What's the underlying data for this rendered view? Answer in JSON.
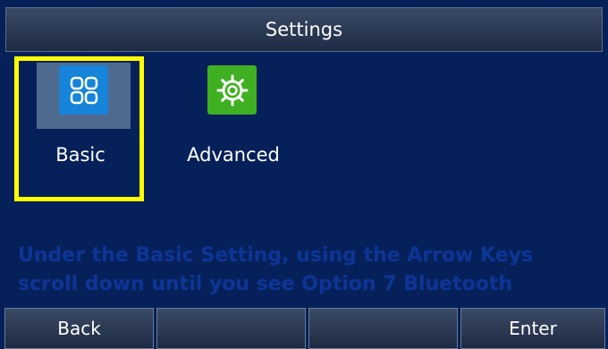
{
  "titlebar": {
    "title": "Settings"
  },
  "menu": {
    "items": [
      {
        "label": "Basic",
        "icon": "grid-icon",
        "color": "#1684d8",
        "selected": true
      },
      {
        "label": "Advanced",
        "icon": "gear-icon",
        "color": "#3fb022",
        "selected": false
      }
    ]
  },
  "hint": {
    "text": "Under the Basic Setting, using the Arrow Keys scroll down until you see Option 7 Bluetooth"
  },
  "softkeys": {
    "k1": "Back",
    "k2": "",
    "k3": "",
    "k4": "Enter"
  },
  "colors": {
    "background": "#06215a",
    "highlight": "#ffff00"
  }
}
